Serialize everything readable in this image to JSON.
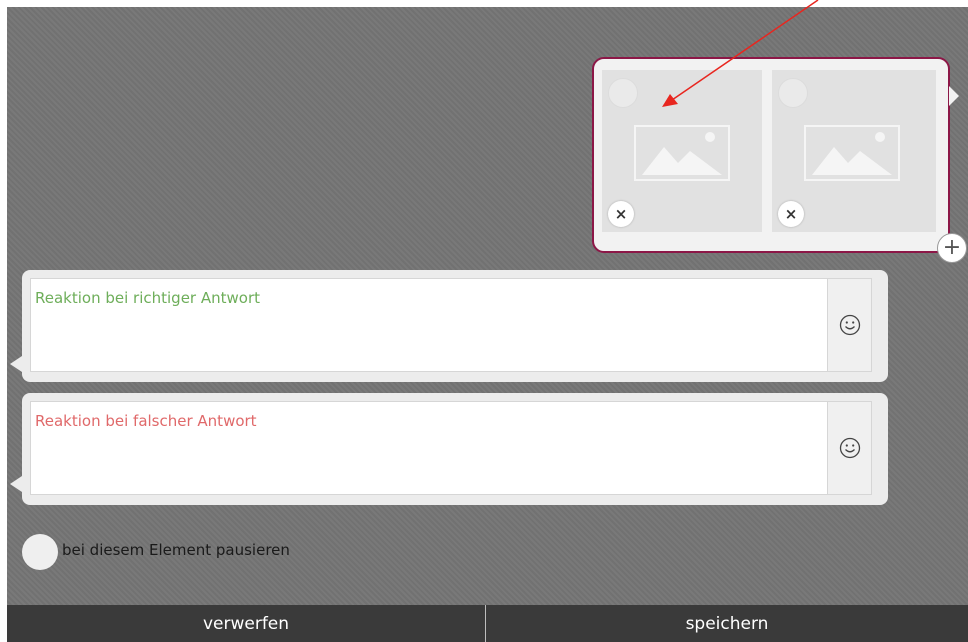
{
  "choice_card": {
    "tiles": [
      {
        "image_icon": "image-placeholder-icon",
        "remove_icon": "close-icon",
        "remove_label": "×"
      },
      {
        "image_icon": "image-placeholder-icon",
        "remove_icon": "close-icon",
        "remove_label": "×"
      }
    ],
    "add_label": "+"
  },
  "reactions": {
    "correct_placeholder": "Reaktion bei richtiger Antwort",
    "wrong_placeholder": "Reaktion bei falscher Antwort",
    "emoji_icon": "smiley-icon"
  },
  "pause": {
    "label": "bei diesem Element pausieren"
  },
  "actions": {
    "discard_label": "verwerfen",
    "save_label": "speichern"
  },
  "colors": {
    "accent_border": "#8c1747",
    "correct_text": "#6eae5a",
    "wrong_text": "#e0696a",
    "annotation_arrow": "#e8261f"
  }
}
